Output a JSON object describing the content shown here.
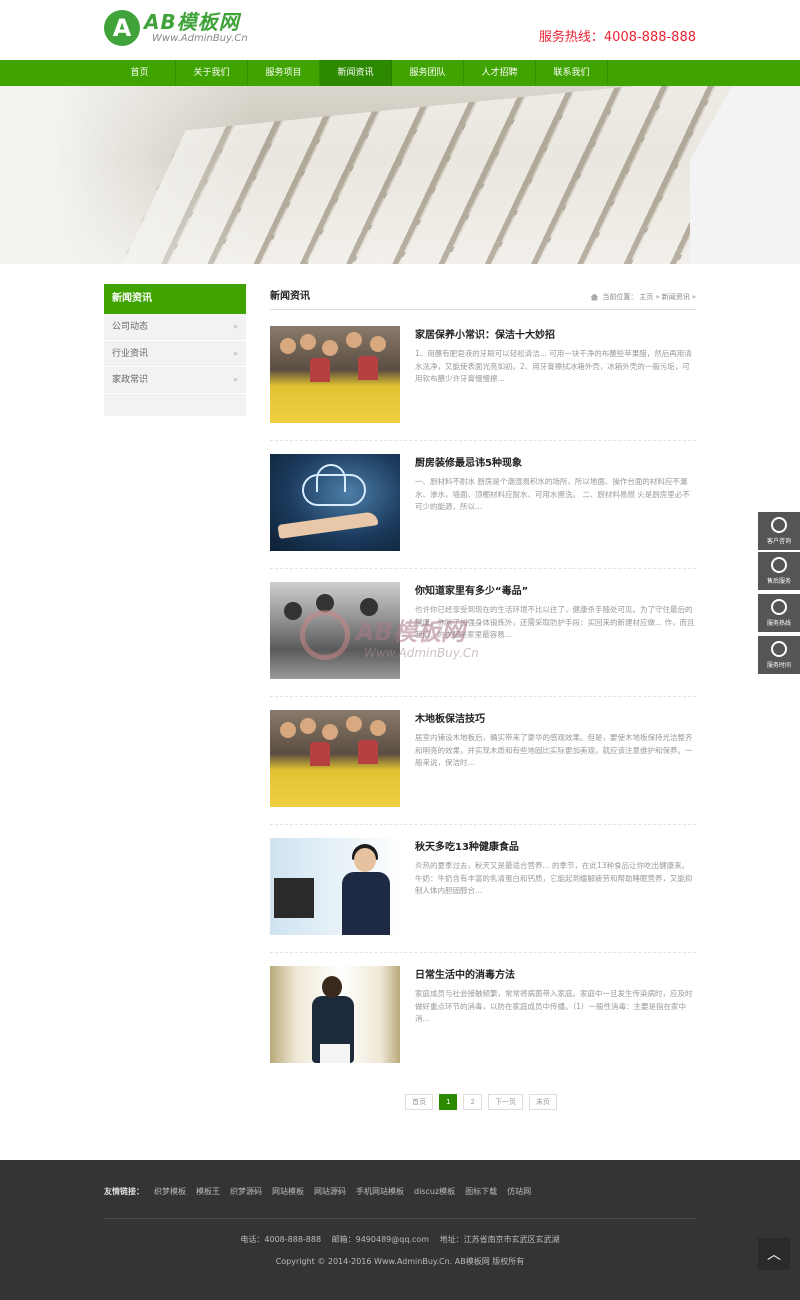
{
  "header": {
    "logo_title": "AB模板网",
    "logo_sub": "Www.AdminBuy.Cn",
    "hotline": "服务热线：4008-888-888"
  },
  "nav": [
    {
      "label": "首页"
    },
    {
      "label": "关于我们"
    },
    {
      "label": "服务项目"
    },
    {
      "label": "新闻资讯",
      "active": true
    },
    {
      "label": "服务团队"
    },
    {
      "label": "人才招聘"
    },
    {
      "label": "联系我们"
    }
  ],
  "sidebar": {
    "heading": "新闻资讯",
    "items": [
      {
        "label": "公司动态"
      },
      {
        "label": "行业资讯"
      },
      {
        "label": "家政常识"
      }
    ],
    "arrow": "»"
  },
  "main": {
    "title": "新闻资讯",
    "breadcrumb": {
      "prefix": "当前位置：",
      "home": "主页",
      "sep": "»",
      "current": "新闻资讯",
      "tail": "»"
    },
    "news": [
      {
        "title": "家居保养小常识：保洁十大妙招",
        "desc": "1、用蘸有肥皂液的牙刷可以轻松清洁... 可用一块干净的布蘸些苹果醋，然后再用清水洗净，又能使表面光亮如初。2、用牙膏擦拭冰箱外壳，冰箱外壳的一般污垢，可用软布蘸少许牙膏慢慢擦..."
      },
      {
        "title": "厨房装修最忌讳5种现象",
        "desc": "一、厨材料不耐水 厨房是个潮湿易积水的场所，所以地面、操作台面的材料应不漏水、渗水，墙面、顶棚材料应耐水、可用水擦洗。 二、厨材料易燃 火是厨房里必不可少的能源，所以..."
      },
      {
        "title": "你知道家里有多少“毒品”",
        "desc": "也许你已经享受到现在的生活环境不比以往了，健康杀手随处可见。为了守住最后的健康，你除了加强身体锻炼外，还需采取防护手段：买回来的新建材应做... 作，而且我们...的衣服是家里最容易..."
      },
      {
        "title": "木地板保洁技巧",
        "desc": "居室内铺设木地板后，确实带来了豪华的感观效果。但是，要使木地板保持光洁整齐和明亮的效果，并实现木质和有些地固比实际更加美观，就应该注意维护和保养。一般来说，保洁时..."
      },
      {
        "title": "秋天多吃13种健康食品",
        "desc": "炎热的夏季过去，秋天又是最适合营养... 的季节，在此13种食品让你吃出健康来。牛奶：牛奶含有丰富的乳清蛋白和钙质，它能起到缓解疲劳和帮助睡眠营养，又能抑制人体内胆固醇合..."
      },
      {
        "title": "日常生活中的消毒方法",
        "desc": "家庭成员与社会接触频繁，常常将病菌带入家庭。家庭中一旦发生传染病时，应及时做好重点环节的消毒，以防在家庭成员中传播。（1）一般性消毒：主要是指在家中消..."
      }
    ]
  },
  "watermark": {
    "title": "AB模板网",
    "sub": "Www.AdminBuy.Cn"
  },
  "pagination": [
    {
      "label": "首页"
    },
    {
      "label": "1",
      "active": true
    },
    {
      "label": "2"
    },
    {
      "label": "下一页"
    },
    {
      "label": "末页"
    }
  ],
  "footer": {
    "links_label": "友情链接：",
    "links": [
      "织梦模板",
      "模板王",
      "织梦源码",
      "网站模板",
      "网站源码",
      "手机网站模板",
      "discuz模板",
      "图标下载",
      "仿站网"
    ],
    "contact": "电话：4008-888-888　 邮箱：9490489@qq.com　 地址：江苏省南京市玄武区玄武湖",
    "copyright": "Copyright © 2014-2016 Www.AdminBuy.Cn. AB模板网 版权所有"
  },
  "float_service": [
    {
      "label": "客户咨询",
      "icon": "qq-icon"
    },
    {
      "label": "售后服务",
      "icon": "headset-icon"
    },
    {
      "label": "服务热线",
      "icon": "phone-icon"
    },
    {
      "label": "服务时间",
      "icon": "clock-icon"
    }
  ],
  "back_to_top": "︿",
  "colors": {
    "brand_green": "#3fa300",
    "nav_active": "#2d8a00",
    "hotline_red": "#e22233",
    "footer_bg": "#343434"
  }
}
